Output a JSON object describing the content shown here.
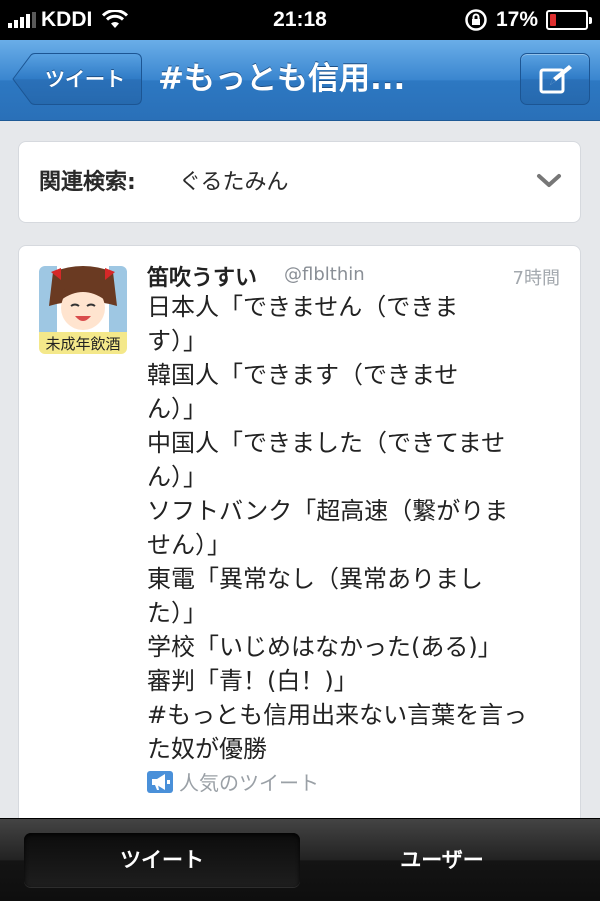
{
  "status_bar": {
    "carrier": "KDDI",
    "time": "21:18",
    "battery": "17%",
    "battery_level": 0.17,
    "battery_color": "#e03030",
    "icons": [
      "signal-icon",
      "wifi-icon",
      "rotation-lock-icon",
      "battery-icon"
    ]
  },
  "nav": {
    "back_label": "ツイート",
    "title": "#もっとも信用...",
    "compose_icon": "compose-icon",
    "accent": "#2d78c2"
  },
  "related_search": {
    "label": "関連検索:",
    "value": "ぐるたみん",
    "icon": "chevron-down-icon"
  },
  "tweet": {
    "name": "笛吹うすい",
    "handle": "@flblthin",
    "time": "7時間",
    "avatar_text": "未成年飲酒",
    "lines": [
      "日本人「できません（できま",
      "す）」",
      "韓国人「できます（できませ",
      "ん）」",
      "中国人「できました（できてませ",
      "ん）」",
      "ソフトバンク「超高速（繋がりま",
      "せん）」",
      "東電「異常なし（異常ありまし",
      "た）」",
      "学校「いじめはなかった(ある)」",
      "審判「青！(白！)」",
      "#もっとも信用出来ない言葉を言っ",
      "た奴が優勝"
    ],
    "popular_label": "人気のツイート"
  },
  "tabs": [
    {
      "label": "ツイート",
      "active": true
    },
    {
      "label": "ユーザー",
      "active": false
    }
  ]
}
